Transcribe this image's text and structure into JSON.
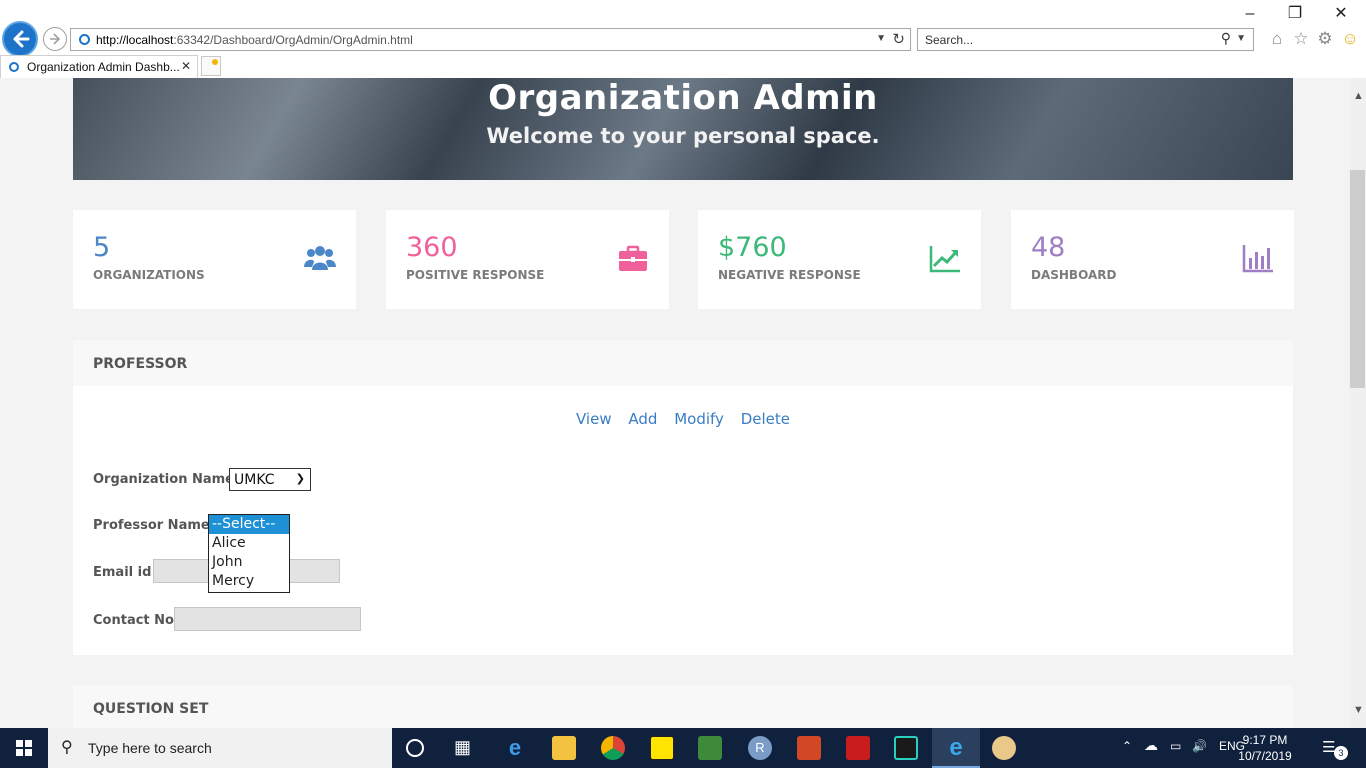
{
  "browser": {
    "url_host": "http://localhost",
    "url_rest": ":63342/Dashboard/OrgAdmin/OrgAdmin.html",
    "search_placeholder": "Search...",
    "tab_title": "Organization Admin Dashb..."
  },
  "hero": {
    "title": "Organization Admin",
    "subtitle": "Welcome to your personal space."
  },
  "stats": [
    {
      "value": "5",
      "label": "ORGANIZATIONS",
      "color": "#4a86c8",
      "icon": "users-icon"
    },
    {
      "value": "360",
      "label": "POSITIVE RESPONSE",
      "color": "#f0609a",
      "icon": "briefcase-icon"
    },
    {
      "value": "$760",
      "label": "NEGATIVE RESPONSE",
      "color": "#3cb878",
      "icon": "trend-up-icon"
    },
    {
      "value": "48",
      "label": "DASHBOARD",
      "color": "#a07ec6",
      "icon": "bar-chart-icon"
    }
  ],
  "professor_panel": {
    "heading": "PROFESSOR",
    "actions": [
      "View",
      "Add",
      "Modify",
      "Delete"
    ],
    "org_label": "Organization Name :",
    "org_value": "UMKC",
    "prof_label": "Professor Name :",
    "prof_options": [
      "--Select--",
      "Alice",
      "John",
      "Mercy"
    ],
    "prof_selected": "--Select--",
    "email_label": "Email id :",
    "contact_label": "Contact No :"
  },
  "question_panel": {
    "heading": "QUESTION SET"
  },
  "taskbar": {
    "search_placeholder": "Type here to search",
    "lang": "ENG",
    "time": "9:17 PM",
    "date": "10/7/2019",
    "notifications": "3"
  }
}
